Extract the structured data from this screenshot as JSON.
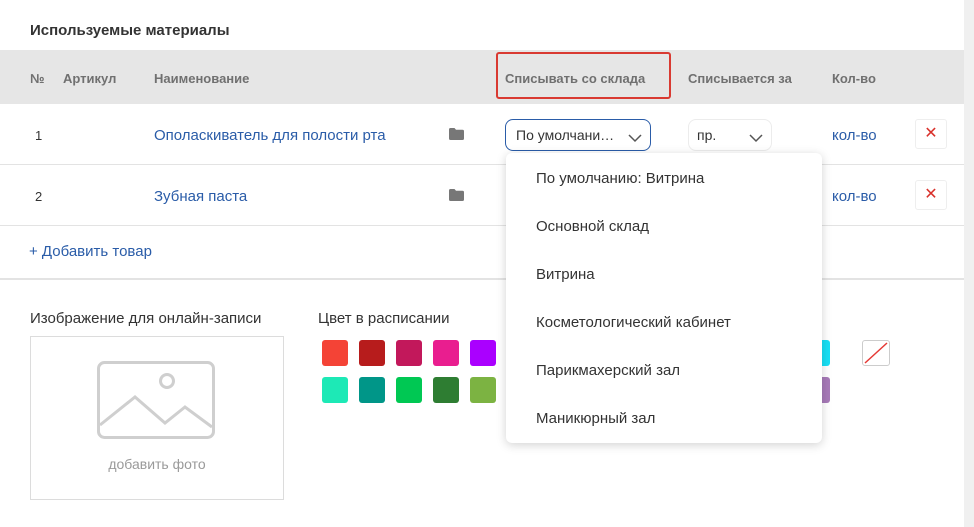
{
  "section": {
    "title": "Используемые материалы"
  },
  "table": {
    "headers": {
      "num": "№",
      "article": "Артикул",
      "name": "Наименование",
      "writeoff_from": "Списывать со склада",
      "writeoff_per": "Списывается за",
      "qty": "Кол-во"
    },
    "rows": [
      {
        "num": "1",
        "name": "Ополаскиватель для полости рта",
        "warehouse": "По умолчани…",
        "unit": "пр.",
        "qty": "кол-во",
        "delete": "✕"
      },
      {
        "num": "2",
        "name": "Зубная паста",
        "qty": "кол-во",
        "delete": "✕"
      }
    ]
  },
  "add_product": "+ Добавить товар",
  "image_section": {
    "label": "Изображение для онлайн-записи",
    "add_photo": "добавить фото"
  },
  "color_section": {
    "label": "Цвет в расписании",
    "colors_row1": [
      "#f44336",
      "#b71c1c",
      "#c2185b",
      "#e91e8f",
      "#aa00ff"
    ],
    "colors_row2": [
      "#1de9b6",
      "#009688",
      "#00c853",
      "#2e7d32",
      "#7cb342"
    ],
    "partial_colors": [
      "#18e0f5",
      "#a77ab8"
    ]
  },
  "dropdown": {
    "options": [
      "По умолчанию: Витрина",
      "Основной склад",
      "Витрина",
      "Косметологический кабинет",
      "Парикмахерский зал",
      "Маникюрный зал"
    ]
  },
  "icons": {
    "folder": "folder-icon",
    "delete": "close-icon",
    "chevron": "chevron-down-icon",
    "image": "image-placeholder-icon"
  },
  "accent_color": "#2a5ca8",
  "highlight_color": "#d93a32"
}
